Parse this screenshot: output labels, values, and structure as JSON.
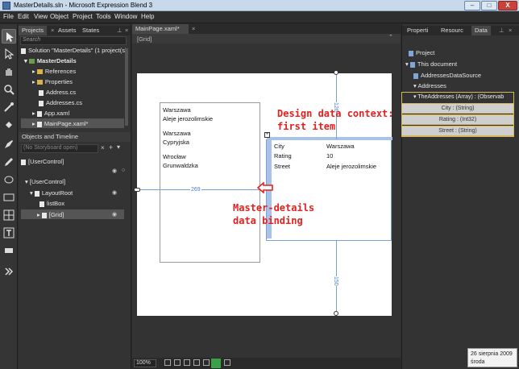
{
  "window": {
    "title": "MasterDetails.sln - Microsoft Expression Blend 3",
    "min": "–",
    "max": "□",
    "close": "X"
  },
  "menu": [
    "File",
    "Edit",
    "View",
    "Object",
    "Project",
    "Tools",
    "Window",
    "Help"
  ],
  "left_panel": {
    "tabs": [
      "Projects",
      "Assets",
      "States"
    ],
    "search_placeholder": "Search",
    "solution_label": "Solution \"MasterDetails\" (1 project(s)",
    "project": "MasterDetails",
    "items": [
      "References",
      "Properties",
      "Address.cs",
      "Addresses.cs",
      "App.xaml",
      "MainPage.xaml*"
    ],
    "objects_title": "Objects and Timeline",
    "storyboard": "(No Storyboard open)",
    "user_control_root": "[UserControl]",
    "user_control": "[UserControl]",
    "layout_root": "LayoutRoot",
    "listbox": "listBox",
    "grid": "[Grid]"
  },
  "document": {
    "tab": "MainPage.xaml*",
    "breadcrumb": "[Grid]",
    "zoom": "100%"
  },
  "artboard": {
    "list_items": [
      {
        "line1": "Warszawa",
        "line2": "Aleje jerozolimskie"
      },
      {
        "line1": "Warszawa",
        "line2": "Cypryjska"
      },
      {
        "line1": "Wrocław",
        "line2": "Grunwaldzka"
      }
    ],
    "details": [
      {
        "label": "City",
        "value": "Warszawa"
      },
      {
        "label": "Rating",
        "value": "10"
      },
      {
        "label": "Street",
        "value": "Aleje jerozolimskie"
      }
    ],
    "dim_width": "269",
    "dim_top": "126",
    "dim_bottom": "150"
  },
  "annotations": {
    "design_line1": "Design data context:",
    "design_line2": "first item",
    "md_line1": "Master-details",
    "md_line2": "data binding"
  },
  "right_panel": {
    "tabs": [
      "Properti",
      "Resourc",
      "Data"
    ],
    "items": [
      "Project",
      "This document",
      "AddressesDataSource",
      "Addresses"
    ],
    "array_label": "TheAddresses (Array) : (Observab",
    "fields": [
      "City : (String)",
      "Rating : (Int32)",
      "Street : (String)"
    ]
  },
  "clock": {
    "date": "26 sierpnia 2009",
    "day": "środa"
  }
}
